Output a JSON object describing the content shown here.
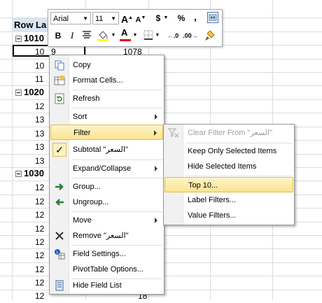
{
  "sheet": {
    "header": "Row La",
    "selected_cell": "9",
    "selected_value": "1078",
    "last_value": "18",
    "rows": [
      {
        "label": "1010",
        "group": true
      },
      {
        "label": "10"
      },
      {
        "label": "10"
      },
      {
        "label": "11"
      },
      {
        "label": "1020",
        "group": true
      },
      {
        "label": "12"
      },
      {
        "label": "13"
      },
      {
        "label": "13"
      },
      {
        "label": "13"
      },
      {
        "label": "13"
      },
      {
        "label": "1030",
        "group": true
      },
      {
        "label": "12"
      },
      {
        "label": "12"
      },
      {
        "label": "12"
      },
      {
        "label": "12"
      },
      {
        "label": "12"
      },
      {
        "label": "12"
      },
      {
        "label": "12"
      },
      {
        "label": "12"
      },
      {
        "label": "12"
      }
    ]
  },
  "mini_toolbar": {
    "font_name": "Arial",
    "font_size": "11",
    "grow_font": "A",
    "shrink_font": "A",
    "currency": "$",
    "percent": "%",
    "comma": ",",
    "bold": "B",
    "italic": "I",
    "font_color": "A"
  },
  "context_menu": {
    "copy": "Copy",
    "format_cells": "Format Cells...",
    "refresh": "Refresh",
    "sort": "Sort",
    "filter": "Filter",
    "subtotal": "Subtotal \"السعر\"",
    "expand_collapse": "Expand/Collapse",
    "group": "Group...",
    "ungroup": "Ungroup...",
    "move": "Move",
    "remove": "Remove \"السعر\"",
    "field_settings": "Field Settings...",
    "pivot_options": "PivotTable Options...",
    "hide_field_list": "Hide Field List"
  },
  "filter_submenu": {
    "clear_filter": "Clear Filter From \"السعر\"",
    "keep_only": "Keep Only Selected Items",
    "hide_selected": "Hide Selected Items",
    "top10": "Top 10...",
    "label_filters": "Label Filters...",
    "value_filters": "Value Filters..."
  },
  "colors": {
    "highlight_top": "#fdf4c9",
    "highlight_bottom": "#fbe48e",
    "highlight_border": "#e1bd4e",
    "header_fill": "#dbe5f1"
  }
}
